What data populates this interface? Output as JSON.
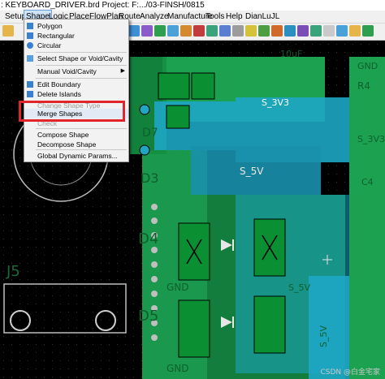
{
  "window": {
    "title": ": KEYBOARD_DRIVER.brd  Project: F:.../03-FINSH/0815"
  },
  "menubar": {
    "items": [
      "Setup",
      "Shape",
      "Logic",
      "Place",
      "FlowPlan",
      "Route",
      "Analyze",
      "Manufacture",
      "Tools",
      "Help",
      "DianLuJL"
    ],
    "active": "Shape"
  },
  "shape_menu": {
    "items": [
      {
        "label": "Polygon",
        "icon": "polygon-icon"
      },
      {
        "label": "Rectangular",
        "icon": "rectangle-icon"
      },
      {
        "label": "Circular",
        "icon": "circle-icon"
      },
      {
        "label": "Select Shape or Void/Cavity",
        "icon": "select-shape-icon"
      },
      {
        "label": "Manual Void/Cavity",
        "submenu": true
      },
      {
        "label": "Edit Boundary",
        "icon": "edit-boundary-icon"
      },
      {
        "label": "Delete Islands",
        "icon": "delete-islands-icon"
      },
      {
        "label": "Change Shape Type",
        "disabled": true
      },
      {
        "label": "Merge Shapes"
      },
      {
        "label": "Check",
        "disabled": true
      },
      {
        "label": "Compose Shape"
      },
      {
        "label": "Decompose Shape"
      },
      {
        "label": "Global Dynamic Params..."
      }
    ],
    "highlighted": "Merge Shapes"
  },
  "board_labels": {
    "net_3v3_top": "S_3V3",
    "net_3v3_right": "S_3V3",
    "net_5v_mid": "S_5V",
    "net_5v_low": "S_5V",
    "net_5v_vertical": "S_5V",
    "gnd_a": "GND",
    "gnd_b": "GND",
    "gnd_c": "GND",
    "ref_j5": "J5",
    "ref_d4": "D4",
    "ref_d5": "D5",
    "ref_c4": "C4",
    "ref_r4": "R4",
    "ref_10uf": "10uF",
    "ref_d3": "D3",
    "ref_d7": "D7"
  },
  "watermark": "CSDN @白金宅家",
  "colors": {
    "copper_green": "#1fb35a",
    "copper_cyan": "#1ea6c4",
    "pad_green": "#0a8f33",
    "accent_red": "#e0262b"
  }
}
